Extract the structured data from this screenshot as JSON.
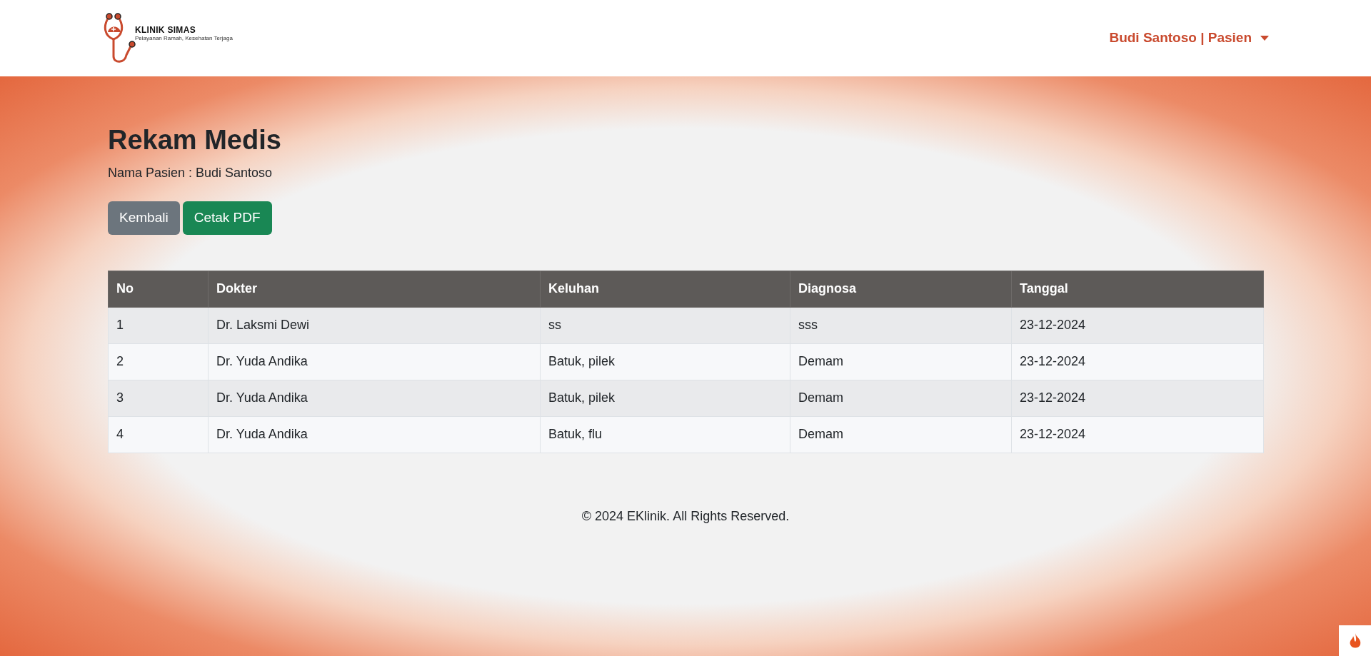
{
  "navbar": {
    "logo": {
      "name": "KLINIK SIMAS",
      "tagline": "Pelayanan Ramah, Kesehatan Terjaga"
    },
    "user_menu": "Budi Santoso | Pasien"
  },
  "page": {
    "title": "Rekam Medis",
    "patient": "Nama Pasien : Budi Santoso"
  },
  "buttons": [
    {
      "label": "Kembali",
      "kind": "secondary"
    },
    {
      "label": "Cetak PDF",
      "kind": "success"
    }
  ],
  "table": {
    "columns": [
      "No",
      "Dokter",
      "Keluhan",
      "Diagnosa",
      "Tanggal"
    ],
    "rows": [
      [
        "1",
        "Dr. Laksmi Dewi",
        "ss",
        "sss",
        "23-12-2024"
      ],
      [
        "2",
        "Dr. Yuda Andika",
        "Batuk, pilek",
        "Demam",
        "23-12-2024"
      ],
      [
        "3",
        "Dr. Yuda Andika",
        "Batuk, pilek",
        "Demam",
        "23-12-2024"
      ],
      [
        "4",
        "Dr. Yuda Andika",
        "Batuk, flu",
        "Demam",
        "23-12-2024"
      ]
    ]
  },
  "footer": "© 2024 EKlinik. All Rights Reserved."
}
